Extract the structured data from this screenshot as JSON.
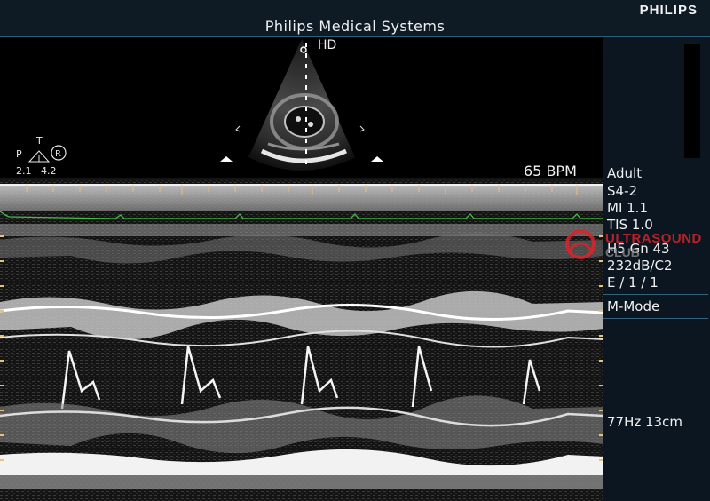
{
  "header": {
    "brand": "PHILIPS",
    "title": "Philips Medical Systems"
  },
  "preview": {
    "label": "HD"
  },
  "probe_orientation": {
    "p": "P",
    "t": "T",
    "r": "R",
    "val_left": "2.1",
    "val_right": "4.2"
  },
  "heart_rate": "65 BPM",
  "params": {
    "preset": "Adult",
    "transducer": "S4-2",
    "mi": "MI 1.1",
    "tis": "TIS 1.0",
    "gain": "H5     Gn 43",
    "dynamic_range": "232dB/C2",
    "persistence": "E / 1 / 1",
    "mode": "M-Mode",
    "frame_depth": "77Hz   13cm"
  },
  "watermark": {
    "text": "ULTRASOUND",
    "sub": "CLUB"
  },
  "colors": {
    "panel": "#0c1620",
    "ecg": "#3fbf3f",
    "accent": "#35617b",
    "watermark": "#d8252a"
  }
}
